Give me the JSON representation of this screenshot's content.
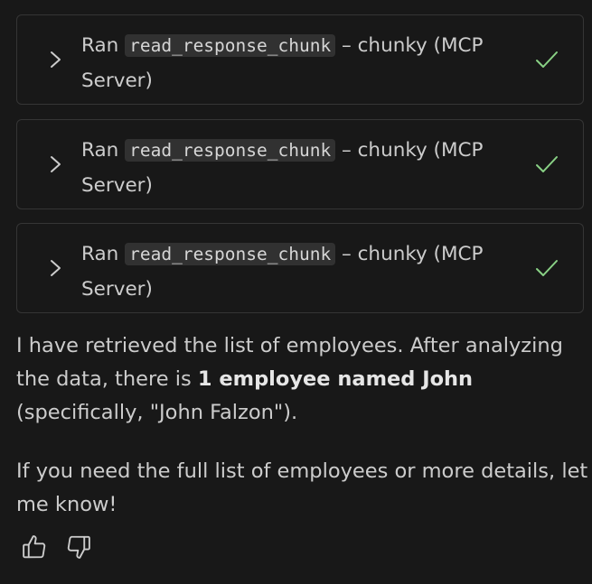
{
  "tool_calls": [
    {
      "prefix": "Ran",
      "tool": "read_response_chunk",
      "suffix": "– chunky (MCP Server)",
      "status": "check-icon"
    },
    {
      "prefix": "Ran",
      "tool": "read_response_chunk",
      "suffix": "– chunky (MCP Server)",
      "status": "check-icon"
    },
    {
      "prefix": "Ran",
      "tool": "read_response_chunk",
      "suffix": "– chunky (MCP Server)",
      "status": "check-icon"
    }
  ],
  "response": {
    "p1_before": "I have retrieved the list of employees. After analyzing the data, there is ",
    "p1_bold": "1 employee named John",
    "p1_after": " (specifically, \"John Falzon\").",
    "p2": "If you need the full list of employees or more details, let me know!"
  },
  "feedback": {
    "like_icon": "thumbs-up-icon",
    "dislike_icon": "thumbs-down-icon"
  },
  "colors": {
    "background": "#181818",
    "border": "#353535",
    "text": "#cccccc",
    "code_bg": "#313131",
    "success": "#89d185"
  }
}
